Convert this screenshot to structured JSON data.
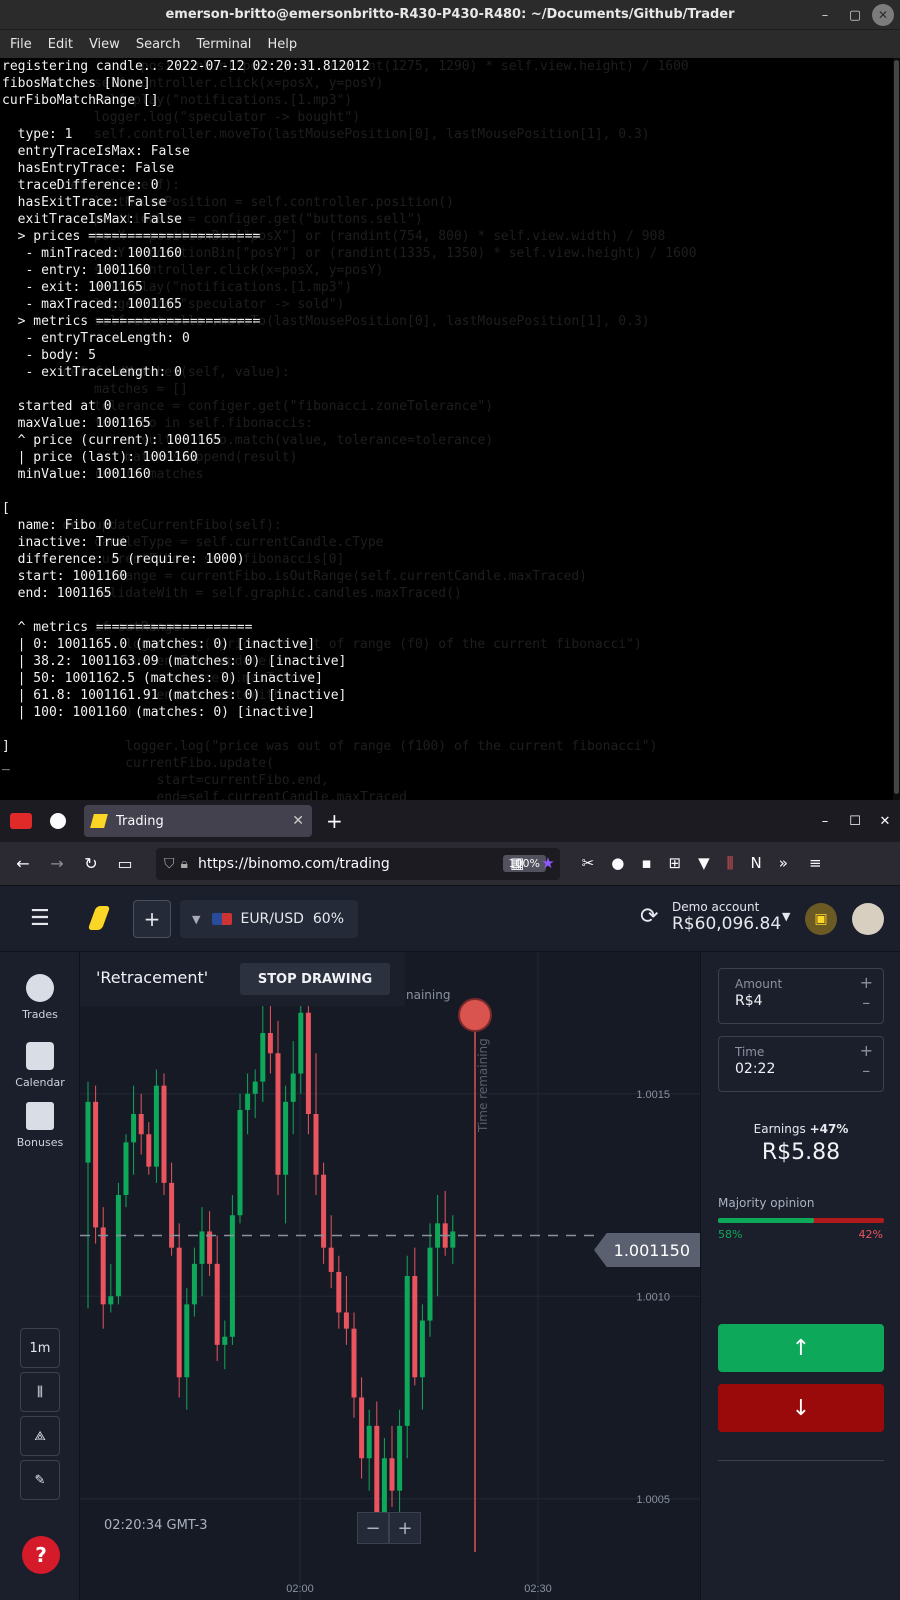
{
  "terminal": {
    "title": "emerson-britto@emersonbritto-R430-P430-R480: ~/Documents/Github/Trader",
    "menu": [
      "File",
      "Edit",
      "View",
      "Search",
      "Terminal",
      "Help"
    ],
    "lines": [
      "registering candle.. 2022-07-12 02:20:31.812012",
      "fibosMatches [None]",
      "curFiboMatchRange []",
      "",
      "  type: 1",
      "  entryTraceIsMax: False",
      "  hasEntryTrace: False",
      "  traceDifference: 0",
      "  hasExitTrace: False",
      "  exitTraceIsMax: False",
      "  > prices ======================",
      "   - minTraced: 1001160",
      "   - entry: 1001160",
      "   - exit: 1001165",
      "   - maxTraced: 1001165",
      "  > metrics =====================",
      "   - entryTraceLength: 0",
      "   - body: 5",
      "   - exitTraceLength: 0",
      "",
      "  started at 0",
      "  maxValue: 1001165",
      "  ^ price (current): 1001165",
      "  | price (last): 1001160",
      "  minValue: 1001160",
      "",
      "[",
      "  name: Fibo 0",
      "  inactive: True",
      "  difference: 5 (require: 1000)",
      "  start: 1001160",
      "  end: 1001165",
      "",
      "  ^ metrics ====================",
      "  | 0: 1001165.0 (matches: 0) [inactive]",
      "  | 38.2: 1001163.09 (matches: 0) [inactive]",
      "  | 50: 1001162.5 (matches: 0) [inactive]",
      "  | 61.8: 1001161.91 (matches: 0) [inactive]",
      "  | 100: 1001160 (matches: 0) [inactive]",
      "",
      "]",
      "_"
    ],
    "ghost_lines": [
      "                  positionBin[\"posY\"] or (randint(1275, 1290) * self.view.height) / 1600",
      "            self.controller.click(x=posX, y=posY)",
      "            self.play(\"notifications.[1.mp3\")",
      "            logger.log(\"speculator -> bought\")",
      "            self.controller.moveTo(lastMousePosition[0], lastMousePosition[1], 0.3)",
      "",
      "",
      "        def sell(self):",
      "            lastMousePosition = self.controller.position()",
      "            positionBin = configer.get(\"buttons.sell\")",
      "            posX = positionBin[\"posX\"] or (randint(754, 800) * self.view.width) / 908",
      "            posY = positionBin[\"posY\"] or (randint(1335, 1350) * self.view.height) / 1600",
      "            self.controller.click(x=posX, y=posY)",
      "            self.play(\"notifications.[1.mp3\")",
      "            logger.log(\"speculator -> sold\")",
      "            self.controller.moveTo(lastMousePosition[0], lastMousePosition[1], 0.3)",
      "",
      "",
      "        def findMatches(self, value):",
      "            matches = []",
      "            tolerance = configer.get(\"fibonacci.zoneTolerance\")",
      "            for fibo in self.fibonaccis:",
      "                result = fibo.match(value, tolerance=tolerance)",
      "                matches.append(result)",
      "            return matches",
      "",
      "",
      "        def updateCurrentFibo(self):",
      "            candleType = self.currentCandle.cType",
      "            currentFibo = self.fibonaccis[0]",
      "            outRange = currentFibo.isOutRange(self.currentCandle.maxTraced)",
      "            validateWith = self.graphic.candles.maxTraced()",
      "",
      "            if outRange:",
      "                logger.log(\"price was out of range (f0) of the current fibonacci\")",
      "                currentFibo.update(",
      "                    start=self.maxTraced,",
      "                    end=validateWith",
      "                )",
      "",
      "                logger.log(\"price was out of range (f100) of the current fibonacci\")",
      "                currentFibo.update(",
      "                    start=currentFibo.end,",
      "                    end=self.currentCandle.maxTraced"
    ]
  },
  "browser": {
    "tab_title": "Trading",
    "url": "https://binomo.com/trading",
    "zoom": "100%"
  },
  "binomo": {
    "asset": "EUR/USD",
    "asset_percent": "60%",
    "account_label": "Demo account",
    "balance": "R$60,096.84",
    "drawing_tool_name": "'Retracement'",
    "stop_drawing": "STOP DRAWING",
    "remaining_fragment": "naining",
    "time_remaining": "Time remaining",
    "nav": [
      "Trades",
      "Calendar",
      "Bonuses"
    ],
    "timeframe": "1m",
    "current_price": "1.001150",
    "clock": "02:20:34 GMT-3",
    "amount_label": "Amount",
    "amount_value": "R$4",
    "time_label": "Time",
    "time_value": "02:22",
    "earnings_label": "Earnings",
    "earnings_percent": "+47%",
    "earnings_value": "R$5.88",
    "majority_label": "Majority opinion",
    "majority_up": "58%",
    "majority_down": "42%",
    "majority_up_fraction": 0.58,
    "colors": {
      "up": "#0ea85a",
      "down": "#e9545e",
      "brand": "#fbd625"
    }
  },
  "chart_data": {
    "type": "candlestick",
    "title": "EUR/USD",
    "y_ticks": [
      "1.0015",
      "1.0010",
      "1.0005"
    ],
    "x_ticks": [
      "02:00",
      "02:30"
    ],
    "ylim": [
      1.00025,
      1.00185
    ],
    "current_price": 1.00115,
    "candles": [
      {
        "o": 1.00133,
        "h": 1.00153,
        "l": 1.00097,
        "c": 1.00148
      },
      {
        "o": 1.00148,
        "h": 1.00152,
        "l": 1.00113,
        "c": 1.00117
      },
      {
        "o": 1.00117,
        "h": 1.00122,
        "l": 1.00092,
        "c": 1.00098
      },
      {
        "o": 1.00098,
        "h": 1.00108,
        "l": 1.00096,
        "c": 1.001
      },
      {
        "o": 1.001,
        "h": 1.00128,
        "l": 1.00098,
        "c": 1.00125
      },
      {
        "o": 1.00125,
        "h": 1.0014,
        "l": 1.00122,
        "c": 1.00138
      },
      {
        "o": 1.00138,
        "h": 1.00152,
        "l": 1.0013,
        "c": 1.00145
      },
      {
        "o": 1.00145,
        "h": 1.0015,
        "l": 1.00135,
        "c": 1.0014
      },
      {
        "o": 1.0014,
        "h": 1.00143,
        "l": 1.0013,
        "c": 1.00132
      },
      {
        "o": 1.00132,
        "h": 1.00156,
        "l": 1.00128,
        "c": 1.00152
      },
      {
        "o": 1.00152,
        "h": 1.00155,
        "l": 1.00125,
        "c": 1.00128
      },
      {
        "o": 1.00128,
        "h": 1.00133,
        "l": 1.0011,
        "c": 1.00112
      },
      {
        "o": 1.00112,
        "h": 1.00118,
        "l": 1.00075,
        "c": 1.0008
      },
      {
        "o": 1.0008,
        "h": 1.00102,
        "l": 1.00072,
        "c": 1.00098
      },
      {
        "o": 1.00098,
        "h": 1.00112,
        "l": 1.00095,
        "c": 1.00108
      },
      {
        "o": 1.00108,
        "h": 1.00122,
        "l": 1.001,
        "c": 1.00116
      },
      {
        "o": 1.00116,
        "h": 1.00121,
        "l": 1.00105,
        "c": 1.00108
      },
      {
        "o": 1.00108,
        "h": 1.00115,
        "l": 1.00084,
        "c": 1.00088
      },
      {
        "o": 1.00088,
        "h": 1.00094,
        "l": 1.00082,
        "c": 1.0009
      },
      {
        "o": 1.0009,
        "h": 1.00125,
        "l": 1.00088,
        "c": 1.0012
      },
      {
        "o": 1.0012,
        "h": 1.0015,
        "l": 1.00118,
        "c": 1.00146
      },
      {
        "o": 1.00146,
        "h": 1.00155,
        "l": 1.0014,
        "c": 1.0015
      },
      {
        "o": 1.0015,
        "h": 1.00156,
        "l": 1.00144,
        "c": 1.00153
      },
      {
        "o": 1.00153,
        "h": 1.00172,
        "l": 1.00148,
        "c": 1.00165
      },
      {
        "o": 1.00165,
        "h": 1.00178,
        "l": 1.00155,
        "c": 1.0016
      },
      {
        "o": 1.0016,
        "h": 1.00168,
        "l": 1.00125,
        "c": 1.0013
      },
      {
        "o": 1.0013,
        "h": 1.00152,
        "l": 1.00118,
        "c": 1.00148
      },
      {
        "o": 1.00148,
        "h": 1.00163,
        "l": 1.0014,
        "c": 1.00155
      },
      {
        "o": 1.00155,
        "h": 1.0018,
        "l": 1.0015,
        "c": 1.0017
      },
      {
        "o": 1.0017,
        "h": 1.00174,
        "l": 1.0014,
        "c": 1.00145
      },
      {
        "o": 1.00145,
        "h": 1.0016,
        "l": 1.00125,
        "c": 1.0013
      },
      {
        "o": 1.0013,
        "h": 1.00133,
        "l": 1.00108,
        "c": 1.00112
      },
      {
        "o": 1.00112,
        "h": 1.0012,
        "l": 1.00102,
        "c": 1.00106
      },
      {
        "o": 1.00106,
        "h": 1.0011,
        "l": 1.00092,
        "c": 1.00096
      },
      {
        "o": 1.00096,
        "h": 1.00105,
        "l": 1.00088,
        "c": 1.00092
      },
      {
        "o": 1.00092,
        "h": 1.00096,
        "l": 1.0007,
        "c": 1.00075
      },
      {
        "o": 1.00075,
        "h": 1.0008,
        "l": 1.00055,
        "c": 1.0006
      },
      {
        "o": 1.0006,
        "h": 1.00072,
        "l": 1.00052,
        "c": 1.00068
      },
      {
        "o": 1.00068,
        "h": 1.00074,
        "l": 1.00042,
        "c": 1.00045
      },
      {
        "o": 1.00045,
        "h": 1.00065,
        "l": 1.0004,
        "c": 1.0006
      },
      {
        "o": 1.0006,
        "h": 1.00068,
        "l": 1.00048,
        "c": 1.00052
      },
      {
        "o": 1.00052,
        "h": 1.00072,
        "l": 1.00046,
        "c": 1.00068
      },
      {
        "o": 1.00068,
        "h": 1.0011,
        "l": 1.0006,
        "c": 1.00105
      },
      {
        "o": 1.00105,
        "h": 1.00112,
        "l": 1.00078,
        "c": 1.0008
      },
      {
        "o": 1.0008,
        "h": 1.00098,
        "l": 1.00072,
        "c": 1.00094
      },
      {
        "o": 1.00094,
        "h": 1.00118,
        "l": 1.0009,
        "c": 1.00112
      },
      {
        "o": 1.00112,
        "h": 1.00125,
        "l": 1.001,
        "c": 1.00118
      },
      {
        "o": 1.00118,
        "h": 1.00126,
        "l": 1.0011,
        "c": 1.00112
      },
      {
        "o": 1.00112,
        "h": 1.0012,
        "l": 1.00108,
        "c": 1.00116
      }
    ]
  }
}
